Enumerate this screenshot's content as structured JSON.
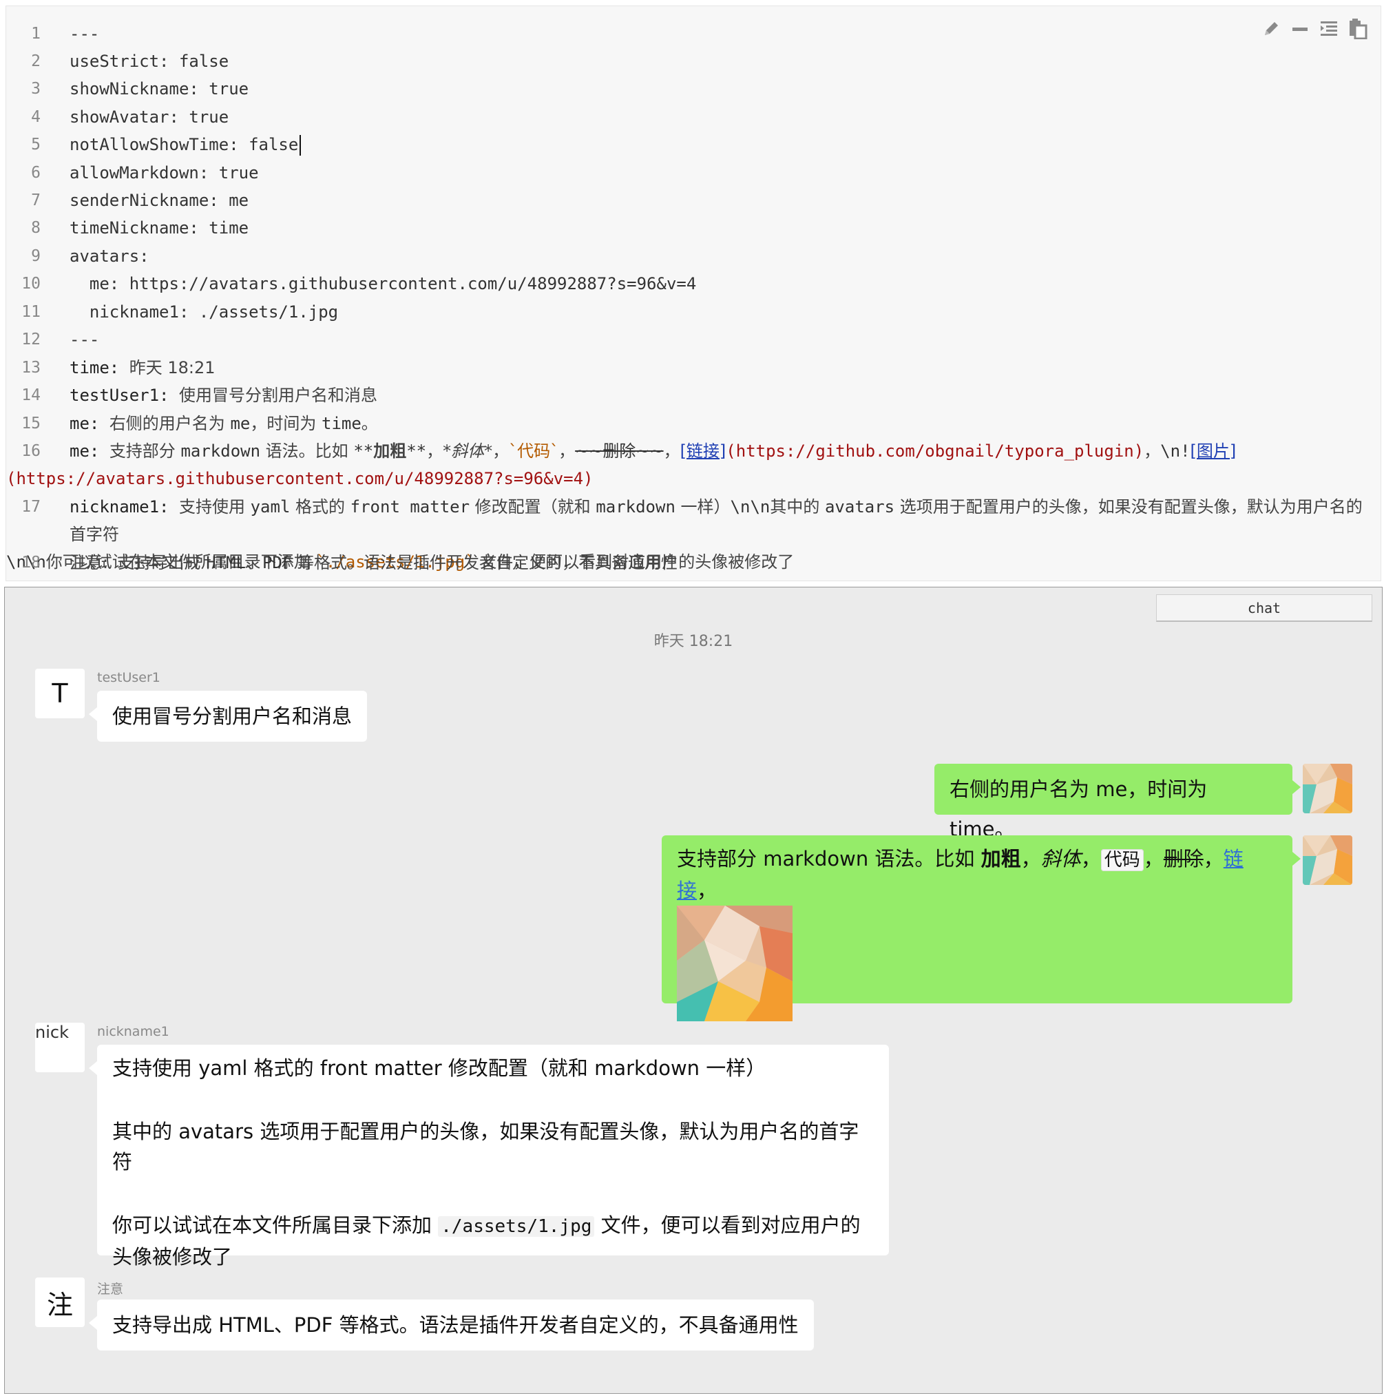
{
  "editor": {
    "lines": [
      {
        "n": "1",
        "text": "---"
      },
      {
        "n": "2",
        "text": "useStrict: false"
      },
      {
        "n": "3",
        "text": "showNickname: true"
      },
      {
        "n": "4",
        "text": "showAvatar: true"
      },
      {
        "n": "5",
        "text": "notAllowShowTime: false"
      },
      {
        "n": "6",
        "text": "allowMarkdown: true"
      },
      {
        "n": "7",
        "text": "senderNickname: me"
      },
      {
        "n": "8",
        "text": "timeNickname: time"
      },
      {
        "n": "9",
        "text": "avatars:"
      },
      {
        "n": "10",
        "text": "  me: https://avatars.githubusercontent.com/u/48992887?s=96&v=4"
      },
      {
        "n": "11",
        "text": "  nickname1: ./assets/1.jpg"
      },
      {
        "n": "12",
        "text": "---"
      },
      {
        "n": "13",
        "key": "time:",
        "val": "昨天 18:21"
      },
      {
        "n": "14",
        "key": "testUser1:",
        "val": "使用冒号分割用户名和消息"
      },
      {
        "n": "15",
        "key": "me:",
        "val_a": "右侧的用户名为 ",
        "val_b": "me",
        "val_c": "，时间为 ",
        "val_d": "time",
        "val_e": "。"
      },
      {
        "n": "16",
        "key": "me:",
        "a": "支持部分 ",
        "b": "markdown",
        "c": " 语法。比如 ",
        "d": "**",
        "e": "加粗",
        "f": "**",
        "g": "，",
        "h": "*",
        "i": "斜体",
        "j": "*",
        "k": "，",
        "l": "`代码`",
        "m": "，",
        "n2": "~~删除~~",
        "o": "，",
        "p": "[链接]",
        "q": "(https://github.com/obgnail/typora_plugin)",
        "r": "，",
        "s": "\\n!",
        "t": "[图片]",
        "u": "(https://avatars.githubusercontent.com/u/48992887?s=96&v=4)"
      },
      {
        "n": "17",
        "key": "nickname1:",
        "a": "支持使用 ",
        "b": "yaml",
        "c": " 格式的 ",
        "d": "front matter",
        "e": " 修改配置（就和 ",
        "f": "markdown",
        "g": " 一样）",
        "h": "\\n\\n",
        "i": "其中的 ",
        "j": "avatars",
        "k": " 选项用于配置用户的头像，如果没有配置头像，默认为用户名的首字符",
        "l": "\\n\\n",
        "m": "你可以试试在本文件所属目录下添加 ",
        "n2": "`./assets/1.jpg`",
        "o": " 文件，便可以看到对应用户的头像被修改了"
      },
      {
        "n": "18",
        "key": "注意:",
        "a": "支持导出成 ",
        "b": "HTML",
        "c": "、",
        "d": "PDF",
        "e": " 等格式。语法是插件开发者自定义的，不具备通用性"
      }
    ],
    "tools": [
      "pencil-icon",
      "minus-icon",
      "indent-icon",
      "paste-icon"
    ]
  },
  "chat": {
    "tab_label": "chat",
    "time": "昨天 18:21",
    "msg1": {
      "nick": "testUser1",
      "avatar_letter": "T",
      "text": "使用冒号分割用户名和消息"
    },
    "msg2": {
      "text": "右侧的用户名为 me，时间为 time。"
    },
    "msg3": {
      "a": "支持部分 markdown 语法。比如 ",
      "bold": "加粗",
      "sep1": "，",
      "italic": "斜体",
      "sep2": "，",
      "code": "代码",
      "sep3": "，",
      "strike": "删除",
      "sep4": "，",
      "link": "链接",
      "sep5": "，"
    },
    "msg4": {
      "nick": "nickname1",
      "avatar_alt": "nick",
      "p1": "支持使用 yaml 格式的 front matter 修改配置（就和 markdown 一样）",
      "p2": "其中的 avatars 选项用于配置用户的头像，如果没有配置头像，默认为用户名的首字符",
      "p3a": "你可以试试在本文件所属目录下添加 ",
      "p3code": "./assets/1.jpg",
      "p3b": " 文件，便可以看到对应用户的头像被修改了"
    },
    "msg5": {
      "nick": "注意",
      "avatar_letter": "注",
      "text": "支持导出成 HTML、PDF 等格式。语法是插件开发者自定义的，不具备通用性"
    }
  },
  "colors": {
    "bubble_right": "#95ec69",
    "bubble_left": "#ffffff",
    "chat_bg": "#ebebeb",
    "editor_bg": "#f7f7f7",
    "link": "#2f6fd6"
  }
}
